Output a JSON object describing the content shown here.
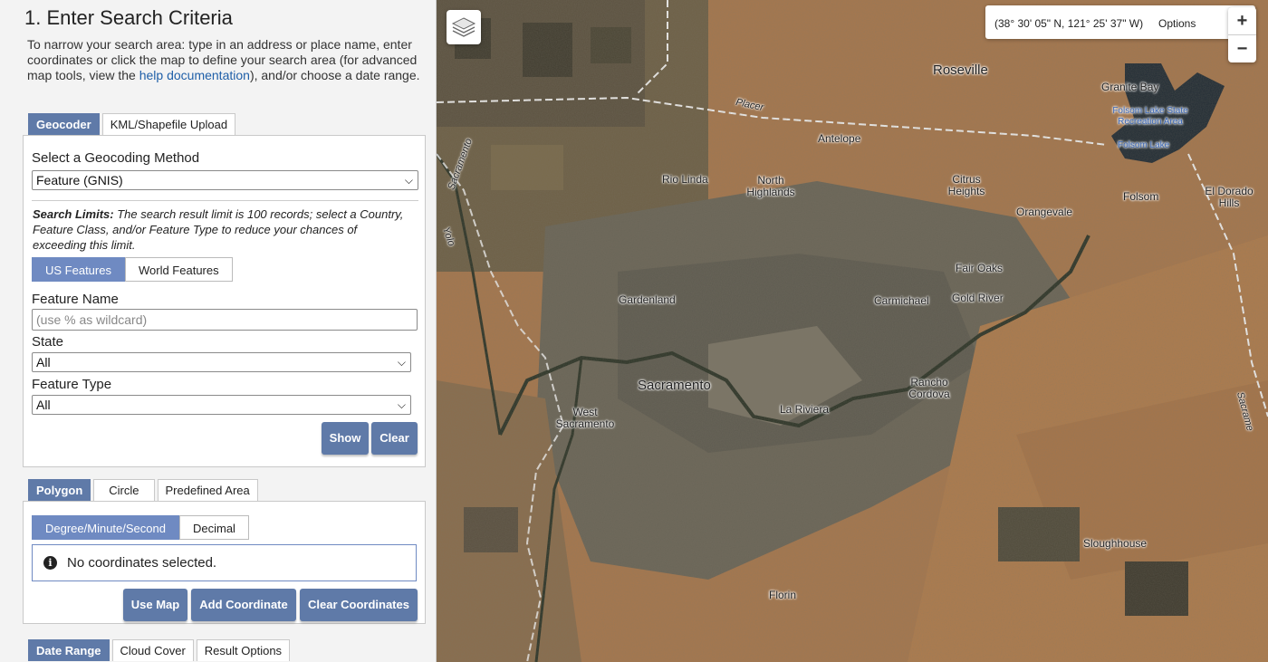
{
  "panel": {
    "title": "1. Enter Search Criteria",
    "intro_prefix": "To narrow your search area: type in an address or place name, enter coordinates or click the map to define your search area (for advanced map tools, view the ",
    "intro_link": "help documentation",
    "intro_suffix": "), and/or choose a date range."
  },
  "geo_tabs": [
    "Geocoder",
    "KML/Shapefile Upload"
  ],
  "geocoder": {
    "method_label": "Select a Geocoding Method",
    "method_value": "Feature (GNIS)",
    "limits_bold": "Search Limits:",
    "limits_text": " The search result limit is 100 records; select a Country, Feature Class, and/or Feature Type to reduce your chances of exceeding this limit.",
    "feature_toggle": [
      "US Features",
      "World Features"
    ],
    "feature_name_label": "Feature Name",
    "feature_name_placeholder": "(use % as wildcard)",
    "state_label": "State",
    "state_value": "All",
    "feature_type_label": "Feature Type",
    "feature_type_value": "All",
    "show_button": "Show",
    "clear_button": "Clear"
  },
  "area_tabs": [
    "Polygon",
    "Circle",
    "Predefined Area"
  ],
  "area": {
    "format_toggle": [
      "Degree/Minute/Second",
      "Decimal"
    ],
    "no_coords": "No coordinates selected.",
    "use_map": "Use Map",
    "add_coordinate": "Add Coordinate",
    "clear_coordinates": "Clear Coordinates"
  },
  "bottom_tabs": [
    "Date Range",
    "Cloud Cover",
    "Result Options"
  ],
  "map": {
    "coordinates": "(38° 30' 05\" N, 121° 25' 37\" W)",
    "options": "Options",
    "zoom_in": "+",
    "zoom_out": "−",
    "places": {
      "roseville": "Roseville",
      "granite_bay": "Granite Bay",
      "folsom_lake_sra": "Folsom Lake State Recreation Area",
      "folsom_lake": "Folsom Lake",
      "placer": "Placer",
      "antelope": "Antelope",
      "rio_linda": "Rio Linda",
      "north_highlands": "North Highlands",
      "citrus_heights": "Citrus Heights",
      "folsom": "Folsom",
      "el_dorado_hills": "El Dorado Hills",
      "orangevale": "Orangevale",
      "fair_oaks": "Fair Oaks",
      "gardenland": "Gardenland",
      "carmichael": "Carmichael",
      "gold_river": "Gold River",
      "sacramento": "Sacramento",
      "west_sacramento": "West Sacramento",
      "la_riviera": "La Riviera",
      "rancho_cordova": "Rancho Cordova",
      "sloughhouse": "Sloughhouse",
      "florin": "Florin",
      "sacramento_county_line": "Sacramento",
      "yolo": "Yolo",
      "sacramento_right": "Sacrame"
    }
  }
}
